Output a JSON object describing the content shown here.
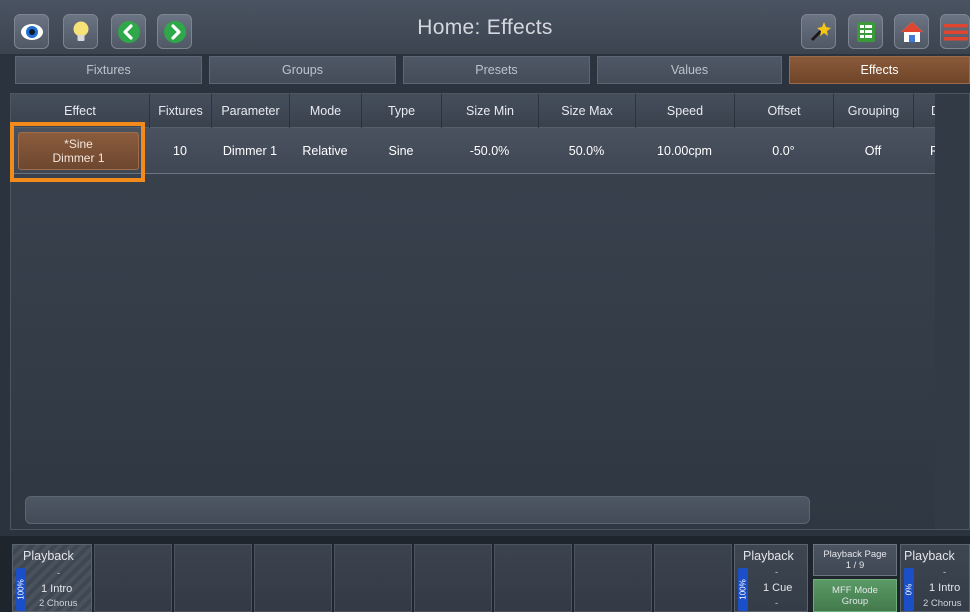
{
  "header": {
    "title": "Home: Effects",
    "left_icons": [
      "eye-icon",
      "lightbulb-icon",
      "back-arrow-icon",
      "forward-arrow-icon"
    ],
    "right_icons": [
      "magic-wand-icon",
      "spreadsheet-icon",
      "home-icon",
      "menu-icon"
    ]
  },
  "tabs": [
    {
      "label": "Fixtures",
      "active": false
    },
    {
      "label": "Groups",
      "active": false
    },
    {
      "label": "Presets",
      "active": false
    },
    {
      "label": "Values",
      "active": false
    },
    {
      "label": "Effects",
      "active": true
    }
  ],
  "table": {
    "columns": [
      "Effect",
      "Fixtures",
      "Parameter",
      "Mode",
      "Type",
      "Size Min",
      "Size Max",
      "Speed",
      "Offset",
      "Grouping",
      "D"
    ],
    "rows": [
      {
        "effect_line1": "*Sine",
        "effect_line2": "Dimmer 1",
        "fixtures": "10",
        "parameter": "Dimmer 1",
        "mode": "Relative",
        "type": "Sine",
        "size_min": "-50.0%",
        "size_max": "50.0%",
        "speed": "10.00cpm",
        "offset": "0.0°",
        "grouping": "Off",
        "d": "F"
      }
    ]
  },
  "playback_left": {
    "label": "Playback",
    "level": "100%",
    "dash": "-",
    "cue": "1 Intro",
    "next": "2 Chorus"
  },
  "playback_mid": {
    "label": "Playback",
    "level": "100%",
    "dash": "-",
    "cue": "1 Cue",
    "next": "-"
  },
  "playback_page": {
    "label": "Playback Page",
    "value": "1 / 9"
  },
  "mff_mode": {
    "label": "MFF Mode",
    "value": "Group"
  },
  "playback_right": {
    "label": "Playback",
    "level": "0%",
    "dash": "-",
    "cue": "1 Intro",
    "next": "2 Chorus"
  },
  "colors": {
    "accent_active": "#8a5a3a",
    "highlight": "#f28a1c",
    "fader_blue": "#1b4fc7",
    "mff_green": "#4f8c5a"
  }
}
